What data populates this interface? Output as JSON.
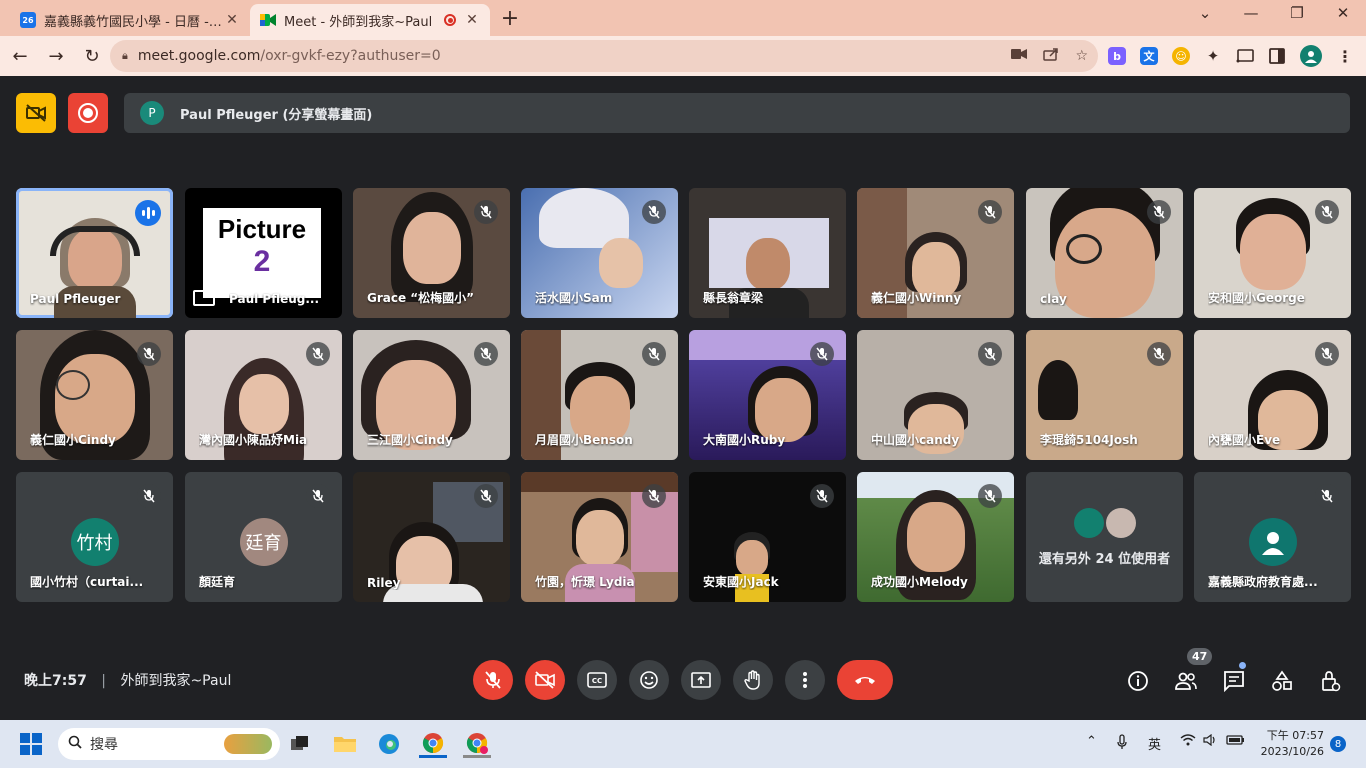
{
  "browser": {
    "tabs": [
      {
        "title": "嘉義縣義竹國民小學 - 日曆 - 活動",
        "favicon_text": "26",
        "favicon_color": "#1a73e8"
      },
      {
        "title": "Meet - 外師到我家~Paul",
        "favicon_color": "#00ac47"
      }
    ],
    "url_host": "meet.google.com",
    "url_path": "/oxr-gvkf-ezy?authuser=0"
  },
  "meet": {
    "presenter": {
      "initial": "P",
      "label": "Paul Pfleuger (分享螢幕畫面)"
    },
    "tiles": [
      {
        "name": "Paul Pfleuger",
        "kind": "video",
        "bg": "#e6e2da",
        "speaking": true
      },
      {
        "name": "Paul Pfleug...",
        "kind": "slide",
        "bg": "#000000",
        "slide_line1": "Picture",
        "slide_line2": "2"
      },
      {
        "name": "Grace “松梅國小”",
        "kind": "video",
        "bg": "#5a4a40",
        "muted": true
      },
      {
        "name": "活水國小Sam",
        "kind": "video",
        "bg": "#6b7da8",
        "muted": true
      },
      {
        "name": "縣長翁章梁",
        "kind": "video",
        "bg": "#3a3532"
      },
      {
        "name": "義仁國小Winny",
        "kind": "video",
        "bg": "#a08a78",
        "muted": true
      },
      {
        "name": "clay",
        "kind": "video",
        "bg": "#c9c4bd",
        "muted": true
      },
      {
        "name": "安和國小George",
        "kind": "video",
        "bg": "#d9d4cc",
        "muted": true
      },
      {
        "name": "義仁國小Cindy",
        "kind": "video",
        "bg": "#7a6a5e",
        "muted": true
      },
      {
        "name": "灣內國小陳品妤Mia",
        "kind": "video",
        "bg": "#d8cfcc",
        "muted": true
      },
      {
        "name": "三江國小Cindy",
        "kind": "video",
        "bg": "#c8c2bd",
        "muted": true
      },
      {
        "name": "月眉國小Benson",
        "kind": "video",
        "bg": "#c4bfb8",
        "muted": true
      },
      {
        "name": "大南國小Ruby",
        "kind": "video",
        "bg": "#4a3a8a",
        "muted": true
      },
      {
        "name": "中山國小candy",
        "kind": "video",
        "bg": "#b8b0a8",
        "muted": true
      },
      {
        "name": "李琨錡5104Josh",
        "kind": "video",
        "bg": "#c9a98a",
        "muted": true
      },
      {
        "name": "內甕國小Eve",
        "kind": "video",
        "bg": "#d8d0c8",
        "muted": true
      },
      {
        "name": "國小竹村（curtai...",
        "kind": "avatar",
        "initials": "竹村",
        "avatar_color": "#12806f",
        "muted": true
      },
      {
        "name": "顏廷育",
        "kind": "avatar",
        "initials": "廷育",
        "avatar_color": "#a1887f",
        "muted": true
      },
      {
        "name": "Riley",
        "kind": "video",
        "bg": "#2a2520",
        "muted": true
      },
      {
        "name": "竹園，忻璟 Lydia",
        "kind": "video",
        "bg": "#9a7a60",
        "muted": true
      },
      {
        "name": "安東國小Jack",
        "kind": "video",
        "bg": "#0c0c0c",
        "muted": true
      },
      {
        "name": "成功國小Melody",
        "kind": "video",
        "bg": "#6f8f5a",
        "muted": true
      },
      {
        "name": "還有另外 24 位使用者",
        "kind": "others"
      },
      {
        "name": "嘉義縣政府教育處...",
        "kind": "avatar",
        "initials": "",
        "avatar_color": "#0f766e",
        "muted": true
      }
    ],
    "time": "晚上7:57",
    "separator": "|",
    "meeting_name": "外師到我家~Paul",
    "participant_count": "47"
  },
  "taskbar": {
    "search_placeholder": "搜尋",
    "ime": "英",
    "clock_time": "下午 07:57",
    "clock_date": "2023/10/26",
    "notifications": "8"
  }
}
